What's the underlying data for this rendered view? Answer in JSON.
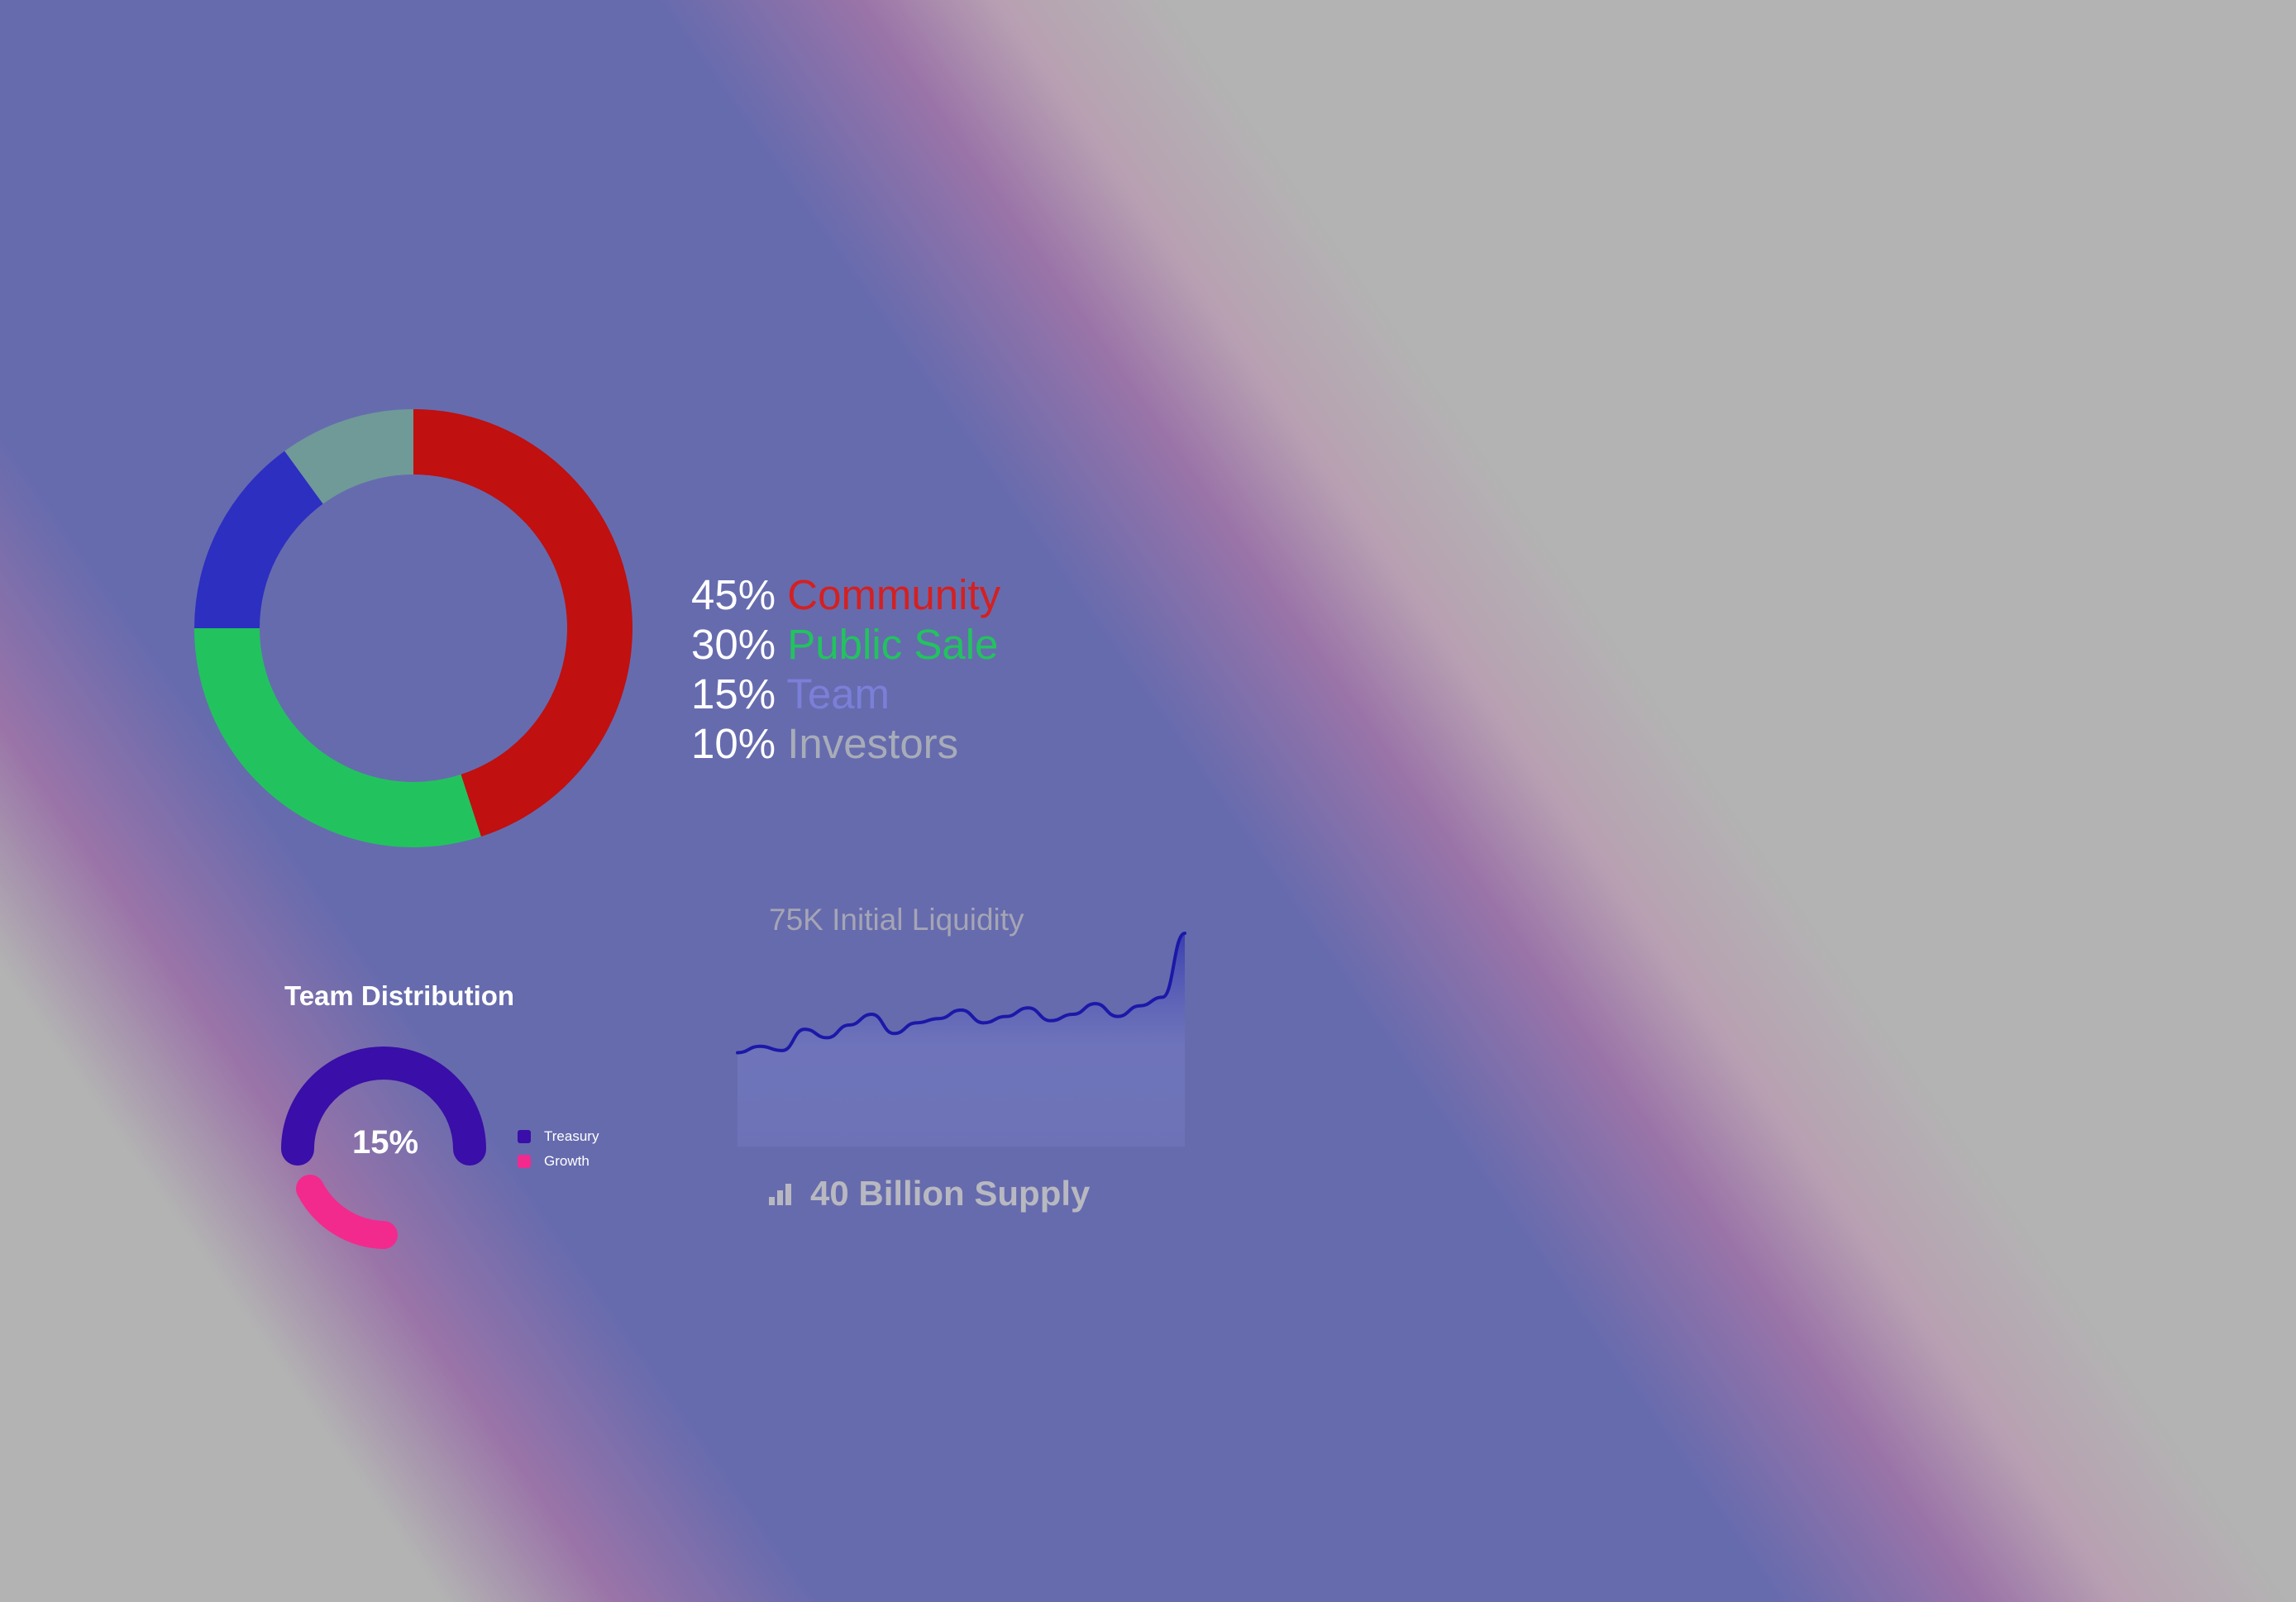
{
  "chart_data": [
    {
      "type": "pie",
      "variant": "donut",
      "slices": [
        {
          "label": "Community",
          "pct_label": "45%",
          "value": 45,
          "color": "#c0100f",
          "label_color": "#d42020"
        },
        {
          "label": "Public Sale",
          "pct_label": "30%",
          "value": 30,
          "color": "#22c35e",
          "label_color": "#22c35e"
        },
        {
          "label": "Team",
          "pct_label": "15%",
          "value": 15,
          "color": "#2c2fc0",
          "label_color": "#7b7fd8"
        },
        {
          "label": "Investors",
          "pct_label": "10%",
          "value": 10,
          "color": "#6f9a98",
          "label_color": "#a8acb8"
        }
      ],
      "legend_placement": "right"
    },
    {
      "type": "gauge",
      "title": "Team Distribution",
      "center_label": "15%",
      "series": [
        {
          "name": "Treasury",
          "color": "#3a0ea8"
        },
        {
          "name": "Growth",
          "color": "#f22a8e"
        }
      ],
      "legend_placement": "right"
    },
    {
      "type": "area",
      "title": "75K Initial Liquidity",
      "caption": "40 Billion Supply",
      "line_color": "#1c18a8",
      "fill_color": "#2a2fb0",
      "values": [
        44,
        47,
        45,
        55,
        51,
        57,
        62,
        53,
        58,
        60,
        64,
        58,
        61,
        65,
        59,
        62,
        67,
        61,
        66,
        70,
        100
      ]
    }
  ],
  "icons": {
    "supply_icon": "bar-chart-icon"
  }
}
